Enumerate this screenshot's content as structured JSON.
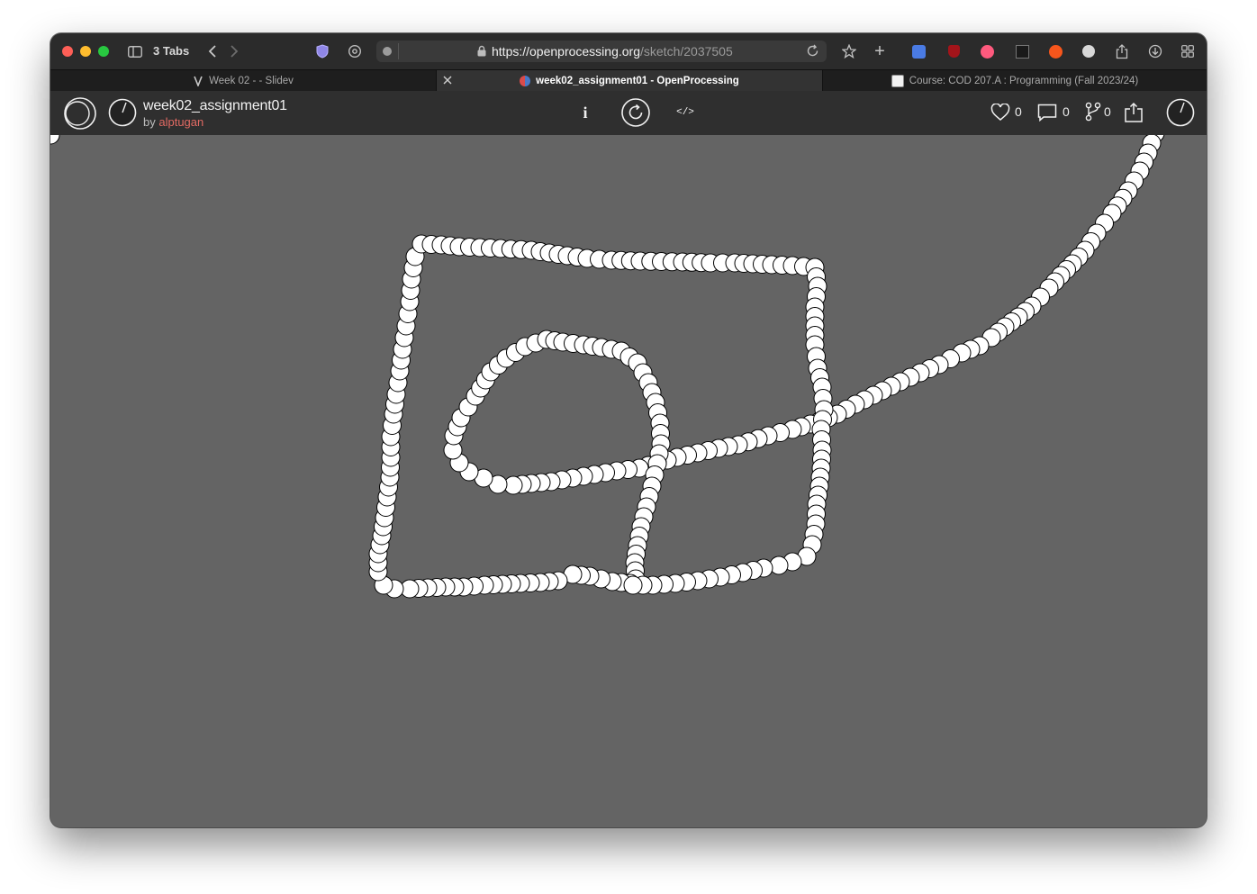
{
  "browser": {
    "tab_count_label": "3 Tabs",
    "url_host": "https://openprocessing.org",
    "url_path": "/sketch/2037505",
    "tabs": [
      {
        "label": "Week 02 - - Slidev"
      },
      {
        "label": "week02_assignment01 - OpenProcessing"
      },
      {
        "label": "Course: COD 207.A : Programming (Fall 2023/24)"
      }
    ]
  },
  "sketch": {
    "title": "week02_assignment01",
    "by_label": "by",
    "author": "alptugan",
    "info_label": "i",
    "code_label": "</>",
    "likes": "0",
    "comments": "0",
    "forks": "0"
  },
  "canvas": {
    "background": "#646464",
    "dot_fill": "#ffffff",
    "dot_stroke": "#000000"
  }
}
